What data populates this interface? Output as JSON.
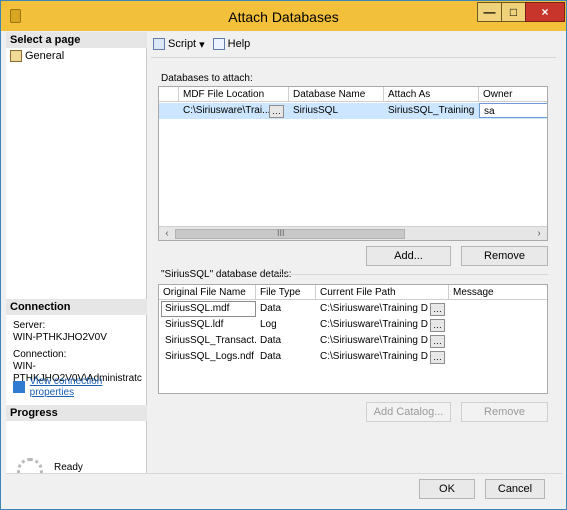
{
  "window": {
    "title": "Attach Databases",
    "controls": {
      "minimize": "—",
      "maximize": "□",
      "close": "×"
    }
  },
  "left": {
    "select_page": "Select a page",
    "general": "General",
    "connection_header": "Connection",
    "server_label": "Server:",
    "server_value": "WIN-PTHKJHO2V0V",
    "connection_label": "Connection:",
    "connection_value": "WIN-PTHKJHO2V0V\\Administratc",
    "view_props": "View connection properties",
    "progress_header": "Progress",
    "progress_status": "Ready"
  },
  "toolbar": {
    "script": "Script",
    "help": "Help"
  },
  "attach": {
    "label": "Databases to attach:",
    "columns": [
      "MDF File Location",
      "Database Name",
      "Attach As",
      "Owner"
    ],
    "rows": [
      {
        "mdf": "C:\\Siriusware\\Trai...",
        "dbname": "SiriusSQL",
        "attach_as": "SiriusSQL_Training",
        "owner": "sa"
      }
    ],
    "scroll_center": "III",
    "add": "Add...",
    "remove": "Remove"
  },
  "details": {
    "label": "\"SiriusSQL\" database details:",
    "columns": [
      "Original File Name",
      "File Type",
      "Current File Path",
      "Message"
    ],
    "rows": [
      {
        "name": "SiriusSQL.mdf",
        "type": "Data",
        "path": "C:\\Siriusware\\Training D..."
      },
      {
        "name": "SiriusSQL.ldf",
        "type": "Log",
        "path": "C:\\Siriusware\\Training D..."
      },
      {
        "name": "SiriusSQL_Transact...",
        "type": "Data",
        "path": "C:\\Siriusware\\Training D..."
      },
      {
        "name": "SiriusSQL_Logs.ndf",
        "type": "Data",
        "path": "C:\\Siriusware\\Training D..."
      }
    ],
    "add_catalog": "Add Catalog...",
    "remove": "Remove"
  },
  "footer": {
    "ok": "OK",
    "cancel": "Cancel"
  },
  "colors": {
    "title_bar": "#f3c03b",
    "selection": "#cde6ff"
  }
}
